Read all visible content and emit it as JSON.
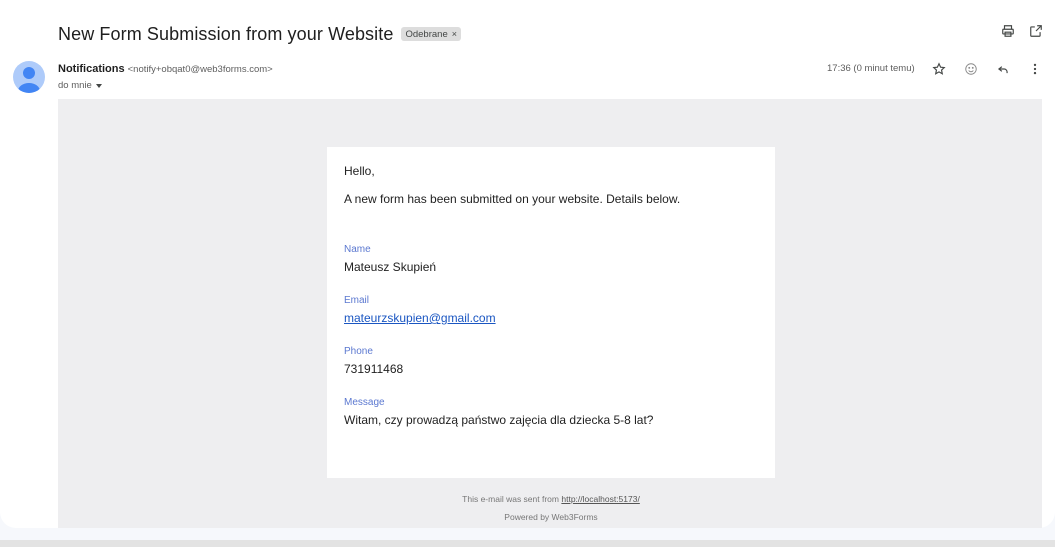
{
  "email": {
    "subject": "New Form Submission from your Website",
    "label": "Odebrane",
    "label_close": "×",
    "sender_name": "Notifications",
    "sender_email": "<notify+obqat0@web3forms.com>",
    "recipient": "do mnie",
    "time": "17:36 (0 minut temu)"
  },
  "icons": {
    "print": "print-icon",
    "open_new": "open-in-new-icon",
    "star": "star-icon",
    "emoji": "emoji-icon",
    "reply": "reply-icon",
    "more": "more-vert-icon",
    "avatar": "person-avatar-icon"
  },
  "message": {
    "greeting": "Hello,",
    "intro": "A new form has been submitted on your website. Details below.",
    "fields": [
      {
        "label": "Name",
        "value": "Mateusz Skupień"
      },
      {
        "label": "Email",
        "value": "mateurzskupien@gmail.com"
      },
      {
        "label": "Phone",
        "value": "731911468"
      },
      {
        "label": "Message",
        "value": "Witam, czy prowadzą państwo zajęcia dla dziecka 5-8 lat?"
      }
    ],
    "footer_prefix": "This e-mail was sent from",
    "footer_link": "http://localhost:5173/",
    "powered_by": "Powered by Web3Forms"
  },
  "colors": {
    "label_blue": "#5b78d0",
    "link_blue": "#1a56c2",
    "body_bg": "#eeeef0",
    "avatar_bg": "#aecbfa",
    "avatar_fg": "#4285f4"
  }
}
